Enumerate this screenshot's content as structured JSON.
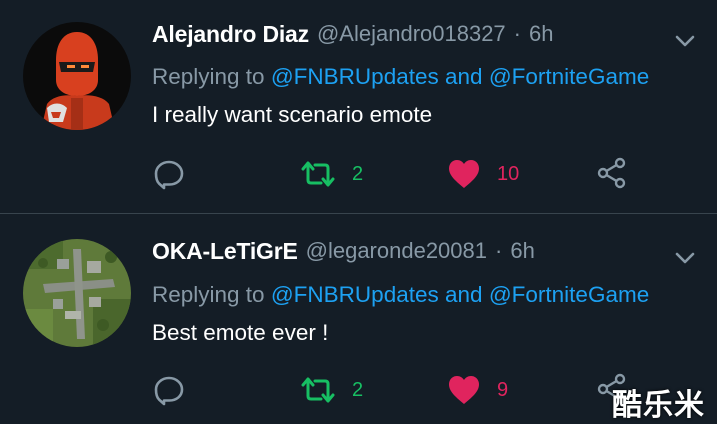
{
  "colors": {
    "background": "#141d26",
    "secondary_text": "#8899a6",
    "mention": "#1da1f2",
    "retweet": "#17bf63",
    "like": "#e0245e",
    "divider": "#38444d"
  },
  "tweets": [
    {
      "name": "Alejandro Diaz",
      "handle": "@Alejandro018327",
      "separator": "·",
      "time": "6h",
      "replying_prefix": "Replying to",
      "mention_1": "@FNBRUpdates",
      "conjunction": "and",
      "mention_2": "@FortniteGame",
      "text": "I really want scenario emote",
      "retweets": "2",
      "likes": "10",
      "icons": [
        "reply-icon",
        "retweet-icon",
        "heart-icon",
        "share-icon",
        "chevron-down-icon"
      ]
    },
    {
      "name": "OKA-LeTiGrE",
      "handle": "@legaronde20081",
      "separator": "·",
      "time": "6h",
      "replying_prefix": "Replying to",
      "mention_1": "@FNBRUpdates",
      "conjunction": "and",
      "mention_2": "@FortniteGame",
      "text": "Best emote ever !",
      "retweets": "2",
      "likes": "9",
      "icons": [
        "reply-icon",
        "retweet-icon",
        "heart-icon",
        "share-icon",
        "chevron-down-icon"
      ]
    }
  ],
  "watermark": "酷乐米"
}
